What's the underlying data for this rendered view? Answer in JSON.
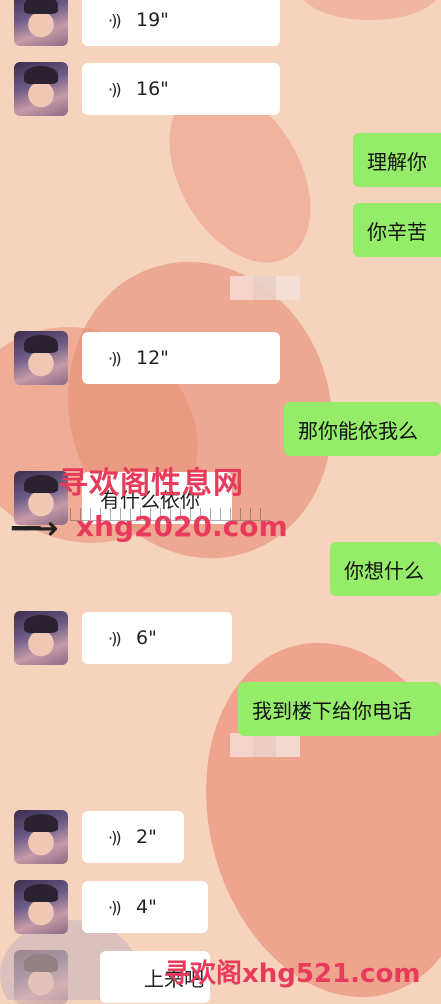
{
  "messages": [
    {
      "side": "in",
      "type": "voice",
      "duration": "19\""
    },
    {
      "side": "in",
      "type": "voice",
      "duration": "16\""
    },
    {
      "side": "out",
      "type": "text",
      "text": "理解你"
    },
    {
      "side": "out",
      "type": "text",
      "text": "你辛苦"
    },
    {
      "side": "in",
      "type": "voice",
      "duration": "12\""
    },
    {
      "side": "out",
      "type": "text",
      "text": "那你能依我么"
    },
    {
      "side": "in",
      "type": "text",
      "text": "有什么依你"
    },
    {
      "side": "out",
      "type": "text",
      "text": "你想什么"
    },
    {
      "side": "in",
      "type": "voice",
      "duration": "6\""
    },
    {
      "side": "out",
      "type": "text",
      "text": "我到楼下给你电话"
    },
    {
      "side": "in",
      "type": "voice",
      "duration": "2\""
    },
    {
      "side": "in",
      "type": "voice",
      "duration": "4\""
    },
    {
      "side": "in",
      "type": "text",
      "text": "上来吧"
    }
  ],
  "watermarks": {
    "site_name": "寻欢阁性息网",
    "site_url": "xhg2020.com",
    "bottom": "寻欢阁xhg521.com"
  },
  "colors": {
    "incoming_bubble": "#ffffff",
    "outgoing_bubble": "#95ec69",
    "watermark": "#e83b5c"
  },
  "icons": {
    "voice": "voice-wave-icon"
  }
}
